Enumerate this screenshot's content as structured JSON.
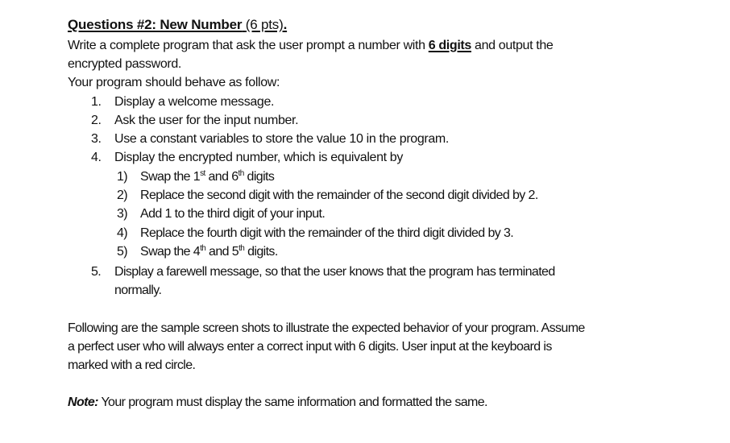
{
  "title": {
    "main": "Questions #2: New Number",
    "points": "(6 pts)",
    "period": "."
  },
  "intro": {
    "line1_pre": "Write a complete program that ask the user prompt a number with ",
    "line1_emph": "6 digits",
    "line1_post": " and output the",
    "line2": "encrypted password.",
    "line3": "Your program should behave as follow:"
  },
  "steps": [
    {
      "num": "1.",
      "text": "Display a welcome message."
    },
    {
      "num": "2.",
      "text": "Ask the user for the input number."
    },
    {
      "num": "3.",
      "text": "Use a constant variables to store the value 10 in the program."
    },
    {
      "num": "4.",
      "text": "Display the encrypted number, which is equivalent by"
    }
  ],
  "substeps": [
    {
      "num": "1)",
      "pre": "Swap the 1",
      "sup1": "st",
      "mid": " and 6",
      "sup2": "th",
      "post": " digits"
    },
    {
      "num": "2)",
      "text": "Replace the second digit with the remainder of the second digit divided by 2."
    },
    {
      "num": "3)",
      "text": "Add 1 to the third digit of your input."
    },
    {
      "num": "4)",
      "text": "Replace the fourth digit with the remainder of the third digit divided by 3."
    },
    {
      "num": "5)",
      "pre": "Swap the 4",
      "sup1": "th",
      "mid": " and 5",
      "sup2": "th",
      "post": " digits."
    }
  ],
  "step5": {
    "num": "5.",
    "line1": "Display a farewell message, so that the user knows that the program has terminated",
    "line2": "normally."
  },
  "paragraph": {
    "line1": "Following are the sample screen shots to illustrate the expected behavior of your program.  Assume",
    "line2": "a perfect user who will always enter a correct input with 6 digits. User input at the keyboard is",
    "line3": "marked with a red circle."
  },
  "note": {
    "label": "Note:",
    "text": " Your program must display the same information and formatted the same."
  }
}
